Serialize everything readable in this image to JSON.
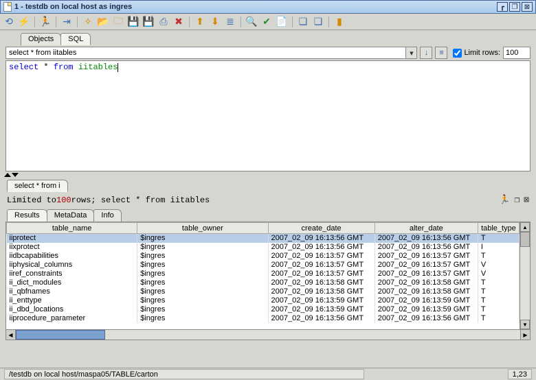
{
  "window": {
    "title": "1 - testdb on local host  as ingres"
  },
  "tabs_top": {
    "objects": "Objects",
    "sql": "SQL"
  },
  "querybar": {
    "combo_value": "select * from iitables",
    "limit_label": "Limit rows:",
    "limit_value": "100"
  },
  "editor": {
    "kw1": "select",
    "star": " * ",
    "kw2": "from",
    "rest": " iitables"
  },
  "result_tab": {
    "label": "select * from i"
  },
  "status_line": {
    "prefix": "Limited to ",
    "count": "100",
    "suffix": "  rows;   select * from iitables"
  },
  "sub_tabs": {
    "results": "Results",
    "metadata": "MetaData",
    "info": "Info"
  },
  "grid": {
    "headers": {
      "c0": "table_name",
      "c1": "table_owner",
      "c2": "create_date",
      "c3": "alter_date",
      "c4": "table_type"
    },
    "rows": [
      {
        "c0": "iiprotect",
        "c1": "$ingres",
        "c2": "2007_02_09 16:13:56 GMT",
        "c3": "2007_02_09 16:13:56 GMT",
        "c4": "T",
        "sel": true
      },
      {
        "c0": "iixprotect",
        "c1": "$ingres",
        "c2": "2007_02_09 16:13:56 GMT",
        "c3": "2007_02_09 16:13:56 GMT",
        "c4": "I",
        "sel": false
      },
      {
        "c0": "iidbcapabilities",
        "c1": "$ingres",
        "c2": "2007_02_09 16:13:57 GMT",
        "c3": "2007_02_09 16:13:57 GMT",
        "c4": "T",
        "sel": false
      },
      {
        "c0": "iiphysical_columns",
        "c1": "$ingres",
        "c2": "2007_02_09 16:13:57 GMT",
        "c3": "2007_02_09 16:13:57 GMT",
        "c4": "V",
        "sel": false
      },
      {
        "c0": "iiref_constraints",
        "c1": "$ingres",
        "c2": "2007_02_09 16:13:57 GMT",
        "c3": "2007_02_09 16:13:57 GMT",
        "c4": "V",
        "sel": false
      },
      {
        "c0": "ii_dict_modules",
        "c1": "$ingres",
        "c2": "2007_02_09 16:13:58 GMT",
        "c3": "2007_02_09 16:13:58 GMT",
        "c4": "T",
        "sel": false
      },
      {
        "c0": "ii_qbfnames",
        "c1": "$ingres",
        "c2": "2007_02_09 16:13:58 GMT",
        "c3": "2007_02_09 16:13:58 GMT",
        "c4": "T",
        "sel": false
      },
      {
        "c0": "ii_enttype",
        "c1": "$ingres",
        "c2": "2007_02_09 16:13:59 GMT",
        "c3": "2007_02_09 16:13:59 GMT",
        "c4": "T",
        "sel": false
      },
      {
        "c0": "ii_dbd_locations",
        "c1": "$ingres",
        "c2": "2007_02_09 16:13:59 GMT",
        "c3": "2007_02_09 16:13:59 GMT",
        "c4": "T",
        "sel": false
      },
      {
        "c0": "iiprocedure_parameter",
        "c1": "$ingres",
        "c2": "2007_02_09 16:13:56 GMT",
        "c3": "2007_02_09 16:13:56 GMT",
        "c4": "T",
        "sel": false
      }
    ]
  },
  "statusbar": {
    "path": "/testdb on local host/maspa05/TABLE/carton",
    "pos": "1,23"
  }
}
